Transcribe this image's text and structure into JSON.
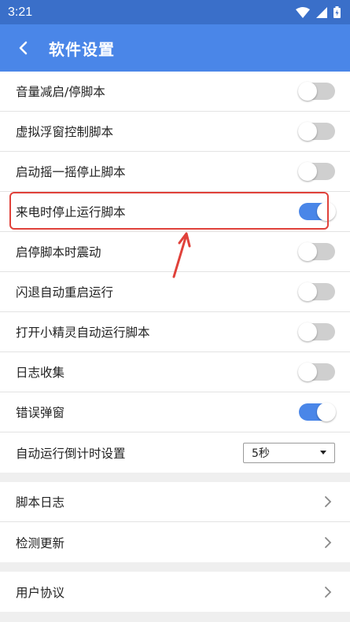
{
  "status_bar": {
    "time": "3:21",
    "icons": [
      "wifi-icon",
      "signal-icon",
      "battery-icon"
    ]
  },
  "header": {
    "title": "软件设置",
    "back_icon": "chevron-left-icon"
  },
  "colors": {
    "accent": "#4a86e8",
    "status_bar": "#3a6fc9",
    "toggle_off": "#cfcfcf",
    "annotation": "#e0413a"
  },
  "settings": [
    {
      "label": "音量减启/停脚本",
      "enabled": false
    },
    {
      "label": "虚拟浮窗控制脚本",
      "enabled": false
    },
    {
      "label": "启动摇一摇停止脚本",
      "enabled": false
    },
    {
      "label": "来电时停止运行脚本",
      "enabled": true
    },
    {
      "label": "启停脚本时震动",
      "enabled": false
    },
    {
      "label": "闪退自动重启运行",
      "enabled": false
    },
    {
      "label": "打开小精灵自动运行脚本",
      "enabled": false
    },
    {
      "label": "日志收集",
      "enabled": false
    },
    {
      "label": "错误弹窗",
      "enabled": true
    }
  ],
  "countdown": {
    "label": "自动运行倒计时设置",
    "value": "5秒"
  },
  "nav_group_1": [
    {
      "label": "脚本日志"
    },
    {
      "label": "检测更新"
    }
  ],
  "nav_group_2": [
    {
      "label": "用户协议"
    }
  ]
}
